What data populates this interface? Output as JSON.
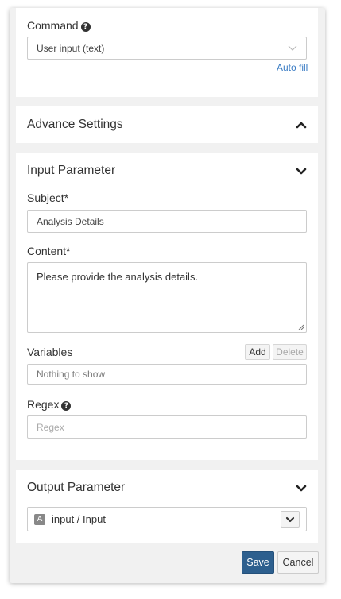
{
  "command": {
    "label": "Command",
    "help_icon": "question-circle-icon",
    "value": "User input (text)",
    "auto_fill": "Auto fill"
  },
  "advance_settings": {
    "title": "Advance Settings",
    "state": "chevron-up"
  },
  "input_parameter": {
    "title": "Input Parameter",
    "state": "chevron-down",
    "subject_label": "Subject*",
    "subject_value": "Analysis Details",
    "content_label": "Content*",
    "content_value": "Please provide the analysis details.",
    "variables_label": "Variables",
    "add_label": "Add",
    "delete_label": "Delete",
    "variables_empty": "Nothing to show",
    "regex_label": "Regex",
    "regex_placeholder": "Regex"
  },
  "output_parameter": {
    "title": "Output Parameter",
    "state": "chevron-down",
    "type_badge": "A",
    "item_label": "input / Input"
  },
  "footer": {
    "save_label": "Save",
    "cancel_label": "Cancel"
  },
  "colors": {
    "save_button": "#2d5f8e",
    "link": "#3a7cc4",
    "panel_bg": "#f1f1f1",
    "card_bg": "#ffffff"
  }
}
